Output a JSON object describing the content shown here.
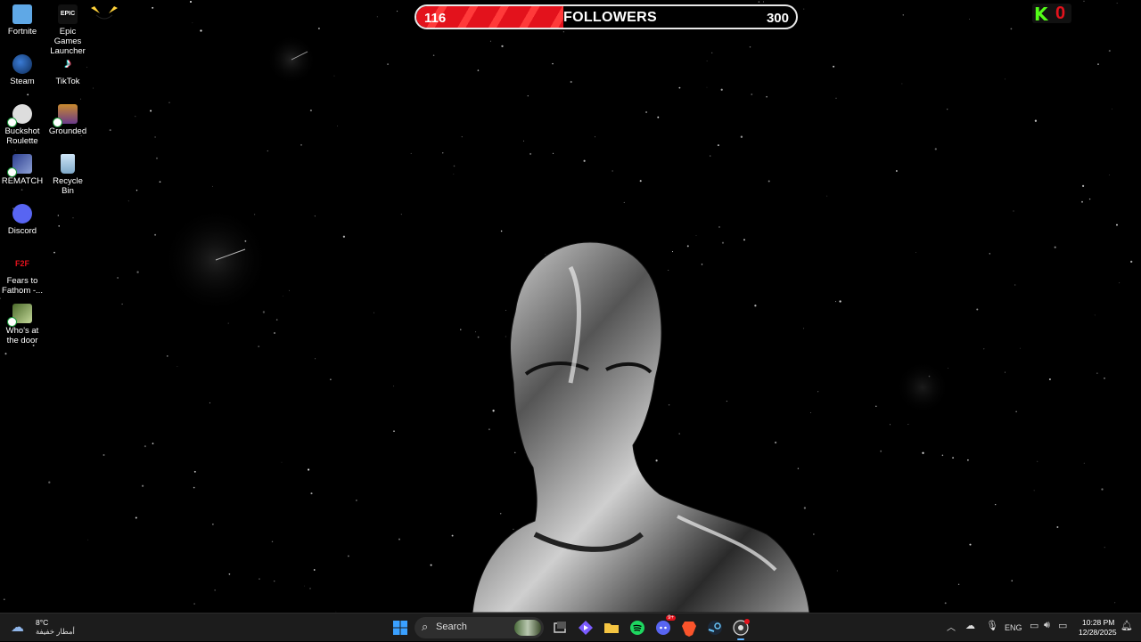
{
  "desktop": {
    "icons": [
      {
        "label": "Fortnite"
      },
      {
        "label": "Epic Games Launcher"
      },
      {
        "label": "Steam"
      },
      {
        "label": "TikTok"
      },
      {
        "label": "Buckshot Roulette"
      },
      {
        "label": "Grounded"
      },
      {
        "label": "REMATCH"
      },
      {
        "label": "Recycle Bin"
      },
      {
        "label": "Discord"
      },
      {
        "label": "Fears to Fathom -..."
      },
      {
        "label": "Who's at the door"
      }
    ],
    "epic_logo_text": "EPIC",
    "f2f_text": "F2F"
  },
  "overlay": {
    "followers": {
      "current": "116",
      "label": "FOLLOWERS",
      "goal": "300",
      "progress": 0.387
    },
    "kick": {
      "logo": "K",
      "count": "0"
    }
  },
  "taskbar": {
    "weather": {
      "temp": "8°C",
      "desc": "أمطار خفيفة"
    },
    "search": {
      "label": "Search"
    },
    "discord_badge": "9+",
    "tray": {
      "language": "ENG"
    },
    "clock": {
      "time": "10:28 PM",
      "date": "12/28/2025"
    }
  },
  "colors": {
    "accent_red": "#e3121c",
    "kick_green": "#53fc18",
    "taskbar_bg": "#1c1c1c"
  }
}
